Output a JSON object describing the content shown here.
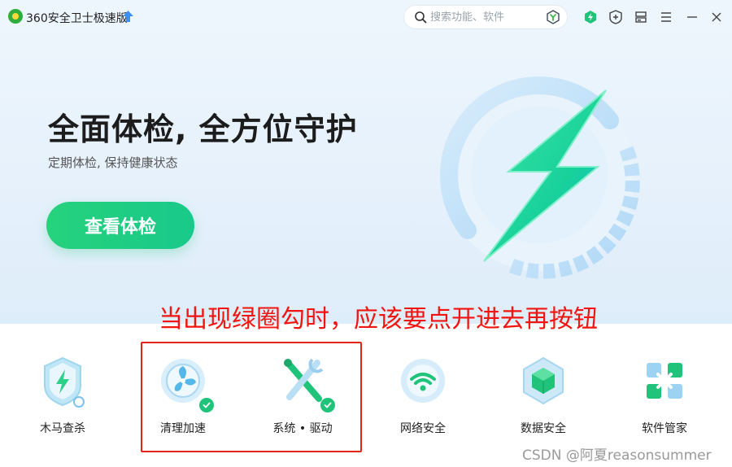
{
  "window": {
    "app_title": "360安全卫士极速版",
    "icons": {
      "logo": "360-logo-icon",
      "upgrade": "upgrade-arrow-icon",
      "shield_green": "green-shield-icon",
      "shield_plus": "shield-plus-icon",
      "skin": "skin-icon",
      "menu": "menu-icon",
      "minimize": "minimize-icon",
      "close": "close-icon"
    }
  },
  "search": {
    "placeholder": "搜索功能、软件",
    "icon": "search-icon",
    "badge_icon": "y-shield-icon"
  },
  "hero": {
    "title": "全面体检, 全方位守护",
    "subtitle": "定期体检, 保持健康状态",
    "button_label": "查看体检",
    "graphic_icon": "lightning-ring-icon"
  },
  "annotation": {
    "text": "当出现绿圈勾时，应该要点开进去再按钮",
    "color": "#f2150f"
  },
  "tools": [
    {
      "label": "木马查杀",
      "icon": "trojan-scan-icon",
      "checked": false
    },
    {
      "label": "清理加速",
      "icon": "cleanup-fan-icon",
      "checked": true
    },
    {
      "label": "系统 • 驱动",
      "icon": "system-tools-icon",
      "checked": true
    },
    {
      "label": "网络安全",
      "icon": "wifi-security-icon",
      "checked": false
    },
    {
      "label": "数据安全",
      "icon": "data-cube-icon",
      "checked": false
    },
    {
      "label": "软件管家",
      "icon": "software-manager-icon",
      "checked": false
    }
  ],
  "watermark": "CSDN @阿夏reasonsummer",
  "colors": {
    "accent_green": "#1fc47a",
    "annotation_red": "#f2150f"
  }
}
